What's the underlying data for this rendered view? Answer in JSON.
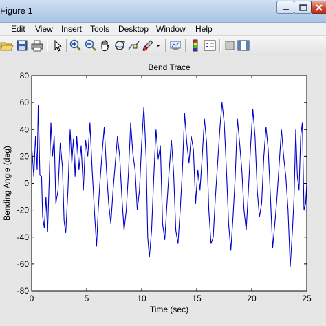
{
  "window": {
    "title": "Figure 1"
  },
  "menu": {
    "items": [
      "Edit",
      "View",
      "Insert",
      "Tools",
      "Desktop",
      "Window",
      "Help"
    ]
  },
  "toolbar": {
    "icons": [
      "open-folder-icon",
      "save-icon",
      "print-icon",
      "pointer-icon",
      "zoom-in-icon",
      "zoom-out-icon",
      "pan-hand-icon",
      "rotate-3d-icon",
      "data-cursor-icon",
      "brush-icon",
      "brush-dropdown-icon",
      "link-plot-icon",
      "colorbar-icon",
      "legend-icon",
      "hide-plot-tools-icon",
      "show-plot-tools-icon"
    ]
  },
  "chart_data": {
    "type": "line",
    "title": "Bend Trace",
    "xlabel": "Time (sec)",
    "ylabel": "Bending Angle (deg)",
    "xlim": [
      0,
      25
    ],
    "ylim": [
      -80,
      80
    ],
    "xticks": [
      0,
      5,
      10,
      15,
      20,
      25
    ],
    "yticks": [
      -80,
      -60,
      -40,
      -20,
      0,
      20,
      40,
      60,
      80
    ],
    "grid": false,
    "series_color": "#0000cc",
    "series": [
      {
        "x": [
          0,
          0.2,
          0.35,
          0.5,
          0.6,
          0.75,
          0.9,
          1.0,
          1.15,
          1.3,
          1.45,
          1.6,
          1.75,
          1.9,
          2.05,
          2.2,
          2.4,
          2.6,
          2.8,
          2.95,
          3.1,
          3.3,
          3.5,
          3.65,
          3.8,
          3.95,
          4.1,
          4.3,
          4.5,
          4.7,
          4.9,
          5.1,
          5.3,
          5.5,
          5.7,
          5.9,
          6.05,
          6.2,
          6.4,
          6.6,
          6.8,
          7.0,
          7.2,
          7.4,
          7.6,
          7.8,
          8.0,
          8.2,
          8.4,
          8.6,
          8.8,
          9.0,
          9.2,
          9.4,
          9.6,
          9.8,
          10.0,
          10.2,
          10.4,
          10.55,
          10.7,
          10.9,
          11.1,
          11.3,
          11.5,
          11.7,
          11.9,
          12.1,
          12.3,
          12.5,
          12.7,
          12.9,
          13.1,
          13.3,
          13.5,
          13.7,
          13.9,
          14.1,
          14.3,
          14.5,
          14.7,
          14.9,
          15.1,
          15.3,
          15.5,
          15.7,
          15.9,
          16.1,
          16.3,
          16.5,
          16.7,
          16.9,
          17.1,
          17.3,
          17.5,
          17.7,
          17.9,
          18.1,
          18.3,
          18.5,
          18.7,
          18.9,
          19.1,
          19.3,
          19.5,
          19.7,
          19.9,
          20.1,
          20.3,
          20.5,
          20.7,
          20.9,
          21.1,
          21.3,
          21.5,
          21.7,
          21.9,
          22.1,
          22.3,
          22.5,
          22.7,
          22.9,
          23.1,
          23.3,
          23.5,
          23.7,
          23.85,
          24.0,
          24.15,
          24.3,
          24.45,
          24.6,
          24.75,
          24.9,
          25.0
        ],
        "y": [
          28,
          5,
          35,
          10,
          58,
          6,
          5,
          -25,
          -33,
          -10,
          -36,
          3,
          45,
          20,
          35,
          -15,
          -5,
          30,
          12,
          -28,
          -37,
          -5,
          40,
          15,
          33,
          5,
          35,
          10,
          28,
          -5,
          32,
          20,
          45,
          10,
          -20,
          -47,
          -20,
          0,
          22,
          42,
          10,
          -15,
          -30,
          -5,
          15,
          35,
          20,
          -10,
          -35,
          -20,
          8,
          45,
          22,
          10,
          -20,
          -5,
          30,
          57,
          20,
          -40,
          -55,
          -35,
          5,
          40,
          18,
          28,
          -30,
          -42,
          -15,
          10,
          32,
          8,
          -35,
          -45,
          -20,
          10,
          52,
          30,
          15,
          35,
          25,
          -15,
          10,
          -5,
          20,
          48,
          30,
          -20,
          -45,
          -40,
          -10,
          15,
          40,
          60,
          45,
          10,
          -30,
          -50,
          -25,
          5,
          48,
          30,
          10,
          -20,
          -35,
          -5,
          28,
          55,
          35,
          -5,
          -25,
          -15,
          20,
          42,
          25,
          -10,
          -48,
          -30,
          -10,
          15,
          40,
          20,
          5,
          -20,
          -62,
          -35,
          -10,
          40,
          5,
          -5,
          35,
          45,
          -20,
          -15,
          0
        ]
      }
    ]
  }
}
